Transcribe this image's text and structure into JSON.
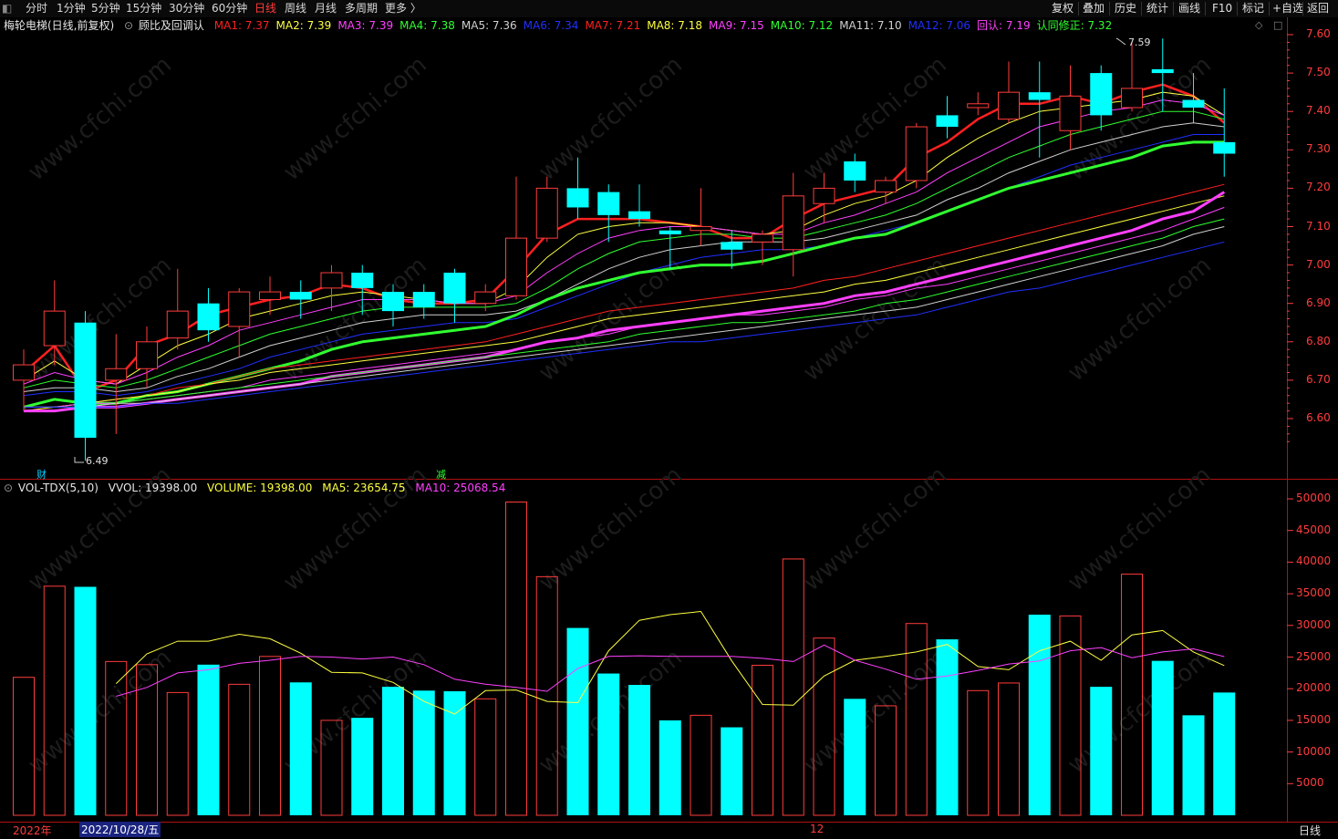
{
  "toolbar": {
    "tabs": [
      "分时",
      "1分钟",
      "5分钟",
      "15分钟",
      "30分钟",
      "60分钟",
      "日线",
      "周线",
      "月线",
      "多周期",
      "更多 〉"
    ],
    "active_tab": "日线",
    "right_buttons": [
      "复权",
      "叠加",
      "历史",
      "统计",
      "画线",
      "F10",
      "标记",
      "+自选",
      "返回"
    ]
  },
  "main_legend": {
    "stock": "梅轮电梯(日线,前复权)",
    "indicator": "顾比及回调认",
    "ma": [
      {
        "label": "MA1: 7.37",
        "color": "#ff2020"
      },
      {
        "label": "MA2: 7.39",
        "color": "#ffff40"
      },
      {
        "label": "MA3: 7.39",
        "color": "#ff40ff"
      },
      {
        "label": "MA4: 7.38",
        "color": "#30ff30"
      },
      {
        "label": "MA5: 7.36",
        "color": "#d0d0d0"
      },
      {
        "label": "MA6: 7.34",
        "color": "#2030ff"
      },
      {
        "label": "MA7: 7.21",
        "color": "#ff2020"
      },
      {
        "label": "MA8: 7.18",
        "color": "#ffff40"
      },
      {
        "label": "MA9: 7.15",
        "color": "#ff40ff"
      },
      {
        "label": "MA10: 7.12",
        "color": "#30ff30"
      },
      {
        "label": "MA11: 7.10",
        "color": "#d0d0d0"
      },
      {
        "label": "MA12: 7.06",
        "color": "#2030ff"
      },
      {
        "label": "回认: 7.19",
        "color": "#ff40ff"
      },
      {
        "label": "认同修正: 7.32",
        "color": "#30ff30"
      }
    ]
  },
  "price_axis": [
    "7.60",
    "7.50",
    "7.40",
    "7.30",
    "7.20",
    "7.10",
    "7.00",
    "6.90",
    "6.80",
    "6.70",
    "6.60"
  ],
  "price_markers": {
    "high": "7.59",
    "low": "6.49",
    "caiwu": "财",
    "jian": "减"
  },
  "vol_legend": {
    "name": "VOL-TDX(5,10)",
    "vvol": "VVOL: 19398.00",
    "volume": "VOLUME: 19398.00",
    "ma5": "MA5: 23654.75",
    "ma10": "MA10: 25068.54"
  },
  "vol_axis": [
    "50000",
    "45000",
    "40000",
    "35000",
    "30000",
    "25000",
    "20000",
    "15000",
    "10000",
    "5000"
  ],
  "bottom": {
    "year": "2022年",
    "date": "2022/10/28/五",
    "month": "12",
    "period": "日线"
  },
  "watermark": "www.cfchi.com",
  "colors": {
    "up": "#ff3c3c",
    "down": "#00ffff",
    "axis": "#ff3c3c",
    "grid": "#3a0000"
  },
  "chart_data": {
    "type": "candlestick",
    "candles": [
      {
        "o": 6.7,
        "c": 6.74,
        "h": 6.78,
        "l": 6.62,
        "v": 21800
      },
      {
        "o": 6.79,
        "c": 6.88,
        "h": 6.96,
        "l": 6.74,
        "v": 36200
      },
      {
        "o": 6.85,
        "c": 6.55,
        "h": 6.88,
        "l": 6.49,
        "v": 36100
      },
      {
        "o": 6.7,
        "c": 6.73,
        "h": 6.82,
        "l": 6.56,
        "v": 24300
      },
      {
        "o": 6.73,
        "c": 6.8,
        "h": 6.84,
        "l": 6.68,
        "v": 23800
      },
      {
        "o": 6.81,
        "c": 6.88,
        "h": 6.99,
        "l": 6.78,
        "v": 19400
      },
      {
        "o": 6.9,
        "c": 6.83,
        "h": 6.94,
        "l": 6.8,
        "v": 23800
      },
      {
        "o": 6.84,
        "c": 6.93,
        "h": 6.94,
        "l": 6.76,
        "v": 20700
      },
      {
        "o": 6.91,
        "c": 6.93,
        "h": 6.97,
        "l": 6.87,
        "v": 25100
      },
      {
        "o": 6.93,
        "c": 6.91,
        "h": 6.96,
        "l": 6.86,
        "v": 21000
      },
      {
        "o": 6.94,
        "c": 6.98,
        "h": 7.0,
        "l": 6.88,
        "v": 15000
      },
      {
        "o": 6.98,
        "c": 6.94,
        "h": 7.0,
        "l": 6.87,
        "v": 15400
      },
      {
        "o": 6.93,
        "c": 6.88,
        "h": 6.95,
        "l": 6.84,
        "v": 20300
      },
      {
        "o": 6.93,
        "c": 6.89,
        "h": 6.95,
        "l": 6.86,
        "v": 19700
      },
      {
        "o": 6.98,
        "c": 6.9,
        "h": 6.99,
        "l": 6.85,
        "v": 19600
      },
      {
        "o": 6.9,
        "c": 6.93,
        "h": 6.95,
        "l": 6.88,
        "v": 18400
      },
      {
        "o": 6.92,
        "c": 7.07,
        "h": 7.23,
        "l": 6.91,
        "v": 49500
      },
      {
        "o": 7.07,
        "c": 7.2,
        "h": 7.23,
        "l": 7.06,
        "v": 37700
      },
      {
        "o": 7.2,
        "c": 7.15,
        "h": 7.28,
        "l": 7.12,
        "v": 29600
      },
      {
        "o": 7.19,
        "c": 7.13,
        "h": 7.21,
        "l": 7.06,
        "v": 22400
      },
      {
        "o": 7.14,
        "c": 7.12,
        "h": 7.21,
        "l": 7.1,
        "v": 20600
      },
      {
        "o": 7.09,
        "c": 7.08,
        "h": 7.1,
        "l": 6.99,
        "v": 15000
      },
      {
        "o": 7.09,
        "c": 7.1,
        "h": 7.2,
        "l": 7.05,
        "v": 15800
      },
      {
        "o": 7.06,
        "c": 7.04,
        "h": 7.09,
        "l": 6.99,
        "v": 13900
      },
      {
        "o": 7.06,
        "c": 7.08,
        "h": 7.09,
        "l": 7.0,
        "v": 23700
      },
      {
        "o": 7.04,
        "c": 7.18,
        "h": 7.24,
        "l": 6.97,
        "v": 40500
      },
      {
        "o": 7.16,
        "c": 7.2,
        "h": 7.24,
        "l": 7.11,
        "v": 28000
      },
      {
        "o": 7.27,
        "c": 7.22,
        "h": 7.29,
        "l": 7.19,
        "v": 18400
      },
      {
        "o": 7.19,
        "c": 7.22,
        "h": 7.23,
        "l": 7.16,
        "v": 17300
      },
      {
        "o": 7.22,
        "c": 7.36,
        "h": 7.37,
        "l": 7.2,
        "v": 30300
      },
      {
        "o": 7.39,
        "c": 7.36,
        "h": 7.44,
        "l": 7.33,
        "v": 27800
      },
      {
        "o": 7.41,
        "c": 7.42,
        "h": 7.45,
        "l": 7.39,
        "v": 19700
      },
      {
        "o": 7.38,
        "c": 7.45,
        "h": 7.53,
        "l": 7.37,
        "v": 20900
      },
      {
        "o": 7.45,
        "c": 7.43,
        "h": 7.53,
        "l": 7.28,
        "v": 31700
      },
      {
        "o": 7.35,
        "c": 7.44,
        "h": 7.52,
        "l": 7.3,
        "v": 31500
      },
      {
        "o": 7.5,
        "c": 7.39,
        "h": 7.52,
        "l": 7.35,
        "v": 20300
      },
      {
        "o": 7.41,
        "c": 7.46,
        "h": 7.58,
        "l": 7.4,
        "v": 38100
      },
      {
        "o": 7.51,
        "c": 7.5,
        "h": 7.59,
        "l": 7.4,
        "v": 24400
      },
      {
        "o": 7.43,
        "c": 7.41,
        "h": 7.5,
        "l": 7.37,
        "v": 15800
      },
      {
        "o": 7.32,
        "c": 7.29,
        "h": 7.46,
        "l": 7.23,
        "v": 19398
      }
    ],
    "ma_lines": [
      {
        "name": "MA1",
        "color": "#ff2020",
        "width": 2.5,
        "values": [
          6.72,
          6.79,
          6.67,
          6.7,
          6.79,
          6.82,
          6.87,
          6.89,
          6.91,
          6.92,
          6.95,
          6.94,
          6.91,
          6.9,
          6.9,
          6.91,
          6.99,
          7.08,
          7.12,
          7.12,
          7.12,
          7.11,
          7.1,
          7.07,
          7.07,
          7.12,
          7.16,
          7.18,
          7.2,
          7.28,
          7.32,
          7.38,
          7.42,
          7.42,
          7.44,
          7.42,
          7.45,
          7.47,
          7.44,
          7.37
        ]
      },
      {
        "name": "MA2",
        "color": "#ffff40",
        "width": 1,
        "values": [
          6.7,
          6.75,
          6.7,
          6.69,
          6.74,
          6.79,
          6.82,
          6.86,
          6.88,
          6.9,
          6.92,
          6.93,
          6.92,
          6.91,
          6.9,
          6.9,
          6.94,
          7.02,
          7.08,
          7.1,
          7.11,
          7.11,
          7.1,
          7.09,
          7.08,
          7.09,
          7.13,
          7.16,
          7.18,
          7.22,
          7.28,
          7.33,
          7.37,
          7.4,
          7.41,
          7.42,
          7.43,
          7.45,
          7.44,
          7.39
        ]
      },
      {
        "name": "MA3",
        "color": "#ff40ff",
        "width": 1,
        "values": [
          6.69,
          6.72,
          6.7,
          6.69,
          6.72,
          6.76,
          6.79,
          6.83,
          6.85,
          6.87,
          6.89,
          6.91,
          6.91,
          6.91,
          6.9,
          6.9,
          6.92,
          6.98,
          7.03,
          7.07,
          7.09,
          7.1,
          7.1,
          7.09,
          7.08,
          7.08,
          7.11,
          7.13,
          7.16,
          7.19,
          7.24,
          7.28,
          7.32,
          7.36,
          7.38,
          7.4,
          7.41,
          7.43,
          7.42,
          7.39
        ]
      },
      {
        "name": "MA4",
        "color": "#30ff30",
        "width": 1,
        "values": [
          6.68,
          6.7,
          6.69,
          6.68,
          6.7,
          6.73,
          6.76,
          6.79,
          6.82,
          6.84,
          6.86,
          6.88,
          6.89,
          6.89,
          6.89,
          6.89,
          6.9,
          6.94,
          6.99,
          7.03,
          7.06,
          7.07,
          7.08,
          7.08,
          7.07,
          7.07,
          7.09,
          7.11,
          7.13,
          7.16,
          7.2,
          7.24,
          7.28,
          7.31,
          7.34,
          7.36,
          7.38,
          7.4,
          7.4,
          7.38
        ]
      },
      {
        "name": "MA5",
        "color": "#d0d0d0",
        "width": 1,
        "values": [
          6.67,
          6.68,
          6.68,
          6.67,
          6.68,
          6.71,
          6.73,
          6.76,
          6.79,
          6.81,
          6.83,
          6.85,
          6.86,
          6.87,
          6.87,
          6.87,
          6.88,
          6.91,
          6.95,
          6.99,
          7.02,
          7.04,
          7.05,
          7.06,
          7.06,
          7.06,
          7.07,
          7.09,
          7.11,
          7.13,
          7.17,
          7.2,
          7.24,
          7.27,
          7.3,
          7.32,
          7.34,
          7.36,
          7.37,
          7.36
        ]
      },
      {
        "name": "MA6",
        "color": "#2030ff",
        "width": 1,
        "values": [
          6.66,
          6.67,
          6.67,
          6.66,
          6.67,
          6.69,
          6.71,
          6.73,
          6.76,
          6.78,
          6.8,
          6.82,
          6.83,
          6.84,
          6.85,
          6.85,
          6.86,
          6.89,
          6.92,
          6.95,
          6.98,
          7.0,
          7.02,
          7.03,
          7.04,
          7.04,
          7.05,
          7.07,
          7.09,
          7.11,
          7.14,
          7.17,
          7.2,
          7.23,
          7.26,
          7.28,
          7.3,
          7.32,
          7.34,
          7.34
        ]
      },
      {
        "name": "认同修正",
        "color": "#30ff30",
        "width": 3,
        "values": [
          6.63,
          6.65,
          6.64,
          6.64,
          6.66,
          6.67,
          6.69,
          6.71,
          6.73,
          6.75,
          6.78,
          6.8,
          6.81,
          6.82,
          6.83,
          6.84,
          6.87,
          6.91,
          6.94,
          6.96,
          6.98,
          6.99,
          7.0,
          7.0,
          7.01,
          7.03,
          7.05,
          7.07,
          7.08,
          7.11,
          7.14,
          7.17,
          7.2,
          7.22,
          7.24,
          7.26,
          7.28,
          7.31,
          7.32,
          7.32
        ]
      },
      {
        "name": "MA7",
        "color": "#ff2020",
        "width": 1,
        "values": [
          6.62,
          6.63,
          6.64,
          6.65,
          6.66,
          6.68,
          6.69,
          6.71,
          6.73,
          6.74,
          6.75,
          6.76,
          6.77,
          6.78,
          6.79,
          6.8,
          6.82,
          6.84,
          6.86,
          6.88,
          6.89,
          6.9,
          6.91,
          6.92,
          6.93,
          6.94,
          6.96,
          6.97,
          6.99,
          7.01,
          7.03,
          7.05,
          7.07,
          7.09,
          7.11,
          7.13,
          7.15,
          7.17,
          7.19,
          7.21
        ]
      },
      {
        "name": "MA8",
        "color": "#ffff40",
        "width": 1,
        "values": [
          6.62,
          6.63,
          6.64,
          6.65,
          6.66,
          6.67,
          6.69,
          6.7,
          6.72,
          6.73,
          6.74,
          6.75,
          6.76,
          6.77,
          6.78,
          6.79,
          6.8,
          6.82,
          6.84,
          6.86,
          6.87,
          6.88,
          6.89,
          6.9,
          6.91,
          6.92,
          6.93,
          6.95,
          6.96,
          6.98,
          7.0,
          7.02,
          7.04,
          7.06,
          7.08,
          7.1,
          7.12,
          7.14,
          7.16,
          7.18
        ]
      },
      {
        "name": "回认",
        "color": "#ff40ff",
        "width": 3,
        "values": [
          6.62,
          6.62,
          6.63,
          6.63,
          6.64,
          6.65,
          6.66,
          6.67,
          6.68,
          6.69,
          6.71,
          6.72,
          6.73,
          6.74,
          6.75,
          6.76,
          6.78,
          6.8,
          6.81,
          6.83,
          6.84,
          6.85,
          6.86,
          6.87,
          6.88,
          6.89,
          6.9,
          6.92,
          6.93,
          6.95,
          6.97,
          6.99,
          7.01,
          7.03,
          7.05,
          7.07,
          7.09,
          7.12,
          7.14,
          7.19
        ]
      },
      {
        "name": "MA9",
        "color": "#ff40ff",
        "width": 1,
        "values": [
          6.63,
          6.63,
          6.64,
          6.64,
          6.65,
          6.66,
          6.67,
          6.68,
          6.7,
          6.71,
          6.72,
          6.73,
          6.74,
          6.75,
          6.76,
          6.77,
          6.78,
          6.8,
          6.81,
          6.82,
          6.84,
          6.85,
          6.86,
          6.87,
          6.87,
          6.88,
          6.89,
          6.91,
          6.92,
          6.94,
          6.95,
          6.97,
          6.99,
          7.01,
          7.03,
          7.05,
          7.07,
          7.09,
          7.12,
          7.15
        ]
      },
      {
        "name": "MA10",
        "color": "#30ff30",
        "width": 1,
        "values": [
          6.63,
          6.63,
          6.63,
          6.64,
          6.65,
          6.66,
          6.67,
          6.68,
          6.69,
          6.7,
          6.71,
          6.72,
          6.73,
          6.74,
          6.75,
          6.76,
          6.77,
          6.78,
          6.79,
          6.8,
          6.82,
          6.83,
          6.84,
          6.85,
          6.85,
          6.86,
          6.87,
          6.88,
          6.9,
          6.91,
          6.93,
          6.95,
          6.97,
          6.99,
          7.01,
          7.03,
          7.05,
          7.07,
          7.1,
          7.12
        ]
      },
      {
        "name": "MA11",
        "color": "#d0d0d0",
        "width": 1,
        "values": [
          6.63,
          6.63,
          6.63,
          6.64,
          6.64,
          6.65,
          6.66,
          6.67,
          6.68,
          6.69,
          6.7,
          6.71,
          6.72,
          6.73,
          6.74,
          6.75,
          6.76,
          6.77,
          6.78,
          6.79,
          6.8,
          6.81,
          6.82,
          6.83,
          6.84,
          6.85,
          6.86,
          6.87,
          6.88,
          6.89,
          6.91,
          6.93,
          6.95,
          6.97,
          6.99,
          7.01,
          7.03,
          7.05,
          7.08,
          7.1
        ]
      },
      {
        "name": "MA12",
        "color": "#2030ff",
        "width": 1,
        "values": [
          6.63,
          6.63,
          6.63,
          6.63,
          6.64,
          6.64,
          6.65,
          6.66,
          6.67,
          6.68,
          6.69,
          6.7,
          6.71,
          6.72,
          6.73,
          6.74,
          6.75,
          6.76,
          6.77,
          6.78,
          6.79,
          6.8,
          6.8,
          6.81,
          6.82,
          6.83,
          6.84,
          6.85,
          6.86,
          6.87,
          6.89,
          6.91,
          6.93,
          6.94,
          6.96,
          6.98,
          7.0,
          7.02,
          7.04,
          7.06
        ]
      }
    ],
    "vol_ma5": [
      20800,
      25500,
      27500,
      27500,
      28600,
      27900,
      25600,
      22600,
      22500,
      21000,
      18000,
      16000,
      19700,
      19800,
      18000,
      17800,
      26000,
      30800,
      31700,
      32200,
      24400,
      17500,
      17400,
      22000,
      24500,
      25100,
      25800,
      27000,
      23500,
      23000,
      26000,
      27500,
      24500,
      28500,
      29200,
      25800,
      23654
    ],
    "vol_ma10": [
      18800,
      20200,
      22500,
      23000,
      24000,
      24500,
      25100,
      25000,
      24700,
      25000,
      23800,
      21500,
      20700,
      20200,
      19600,
      23200,
      25100,
      25200,
      25100,
      25100,
      25100,
      24800,
      24300,
      26900,
      24500,
      23100,
      21500,
      22000,
      22900,
      23900,
      24400,
      26000,
      26500,
      24900,
      25800,
      26300,
      25068
    ]
  }
}
